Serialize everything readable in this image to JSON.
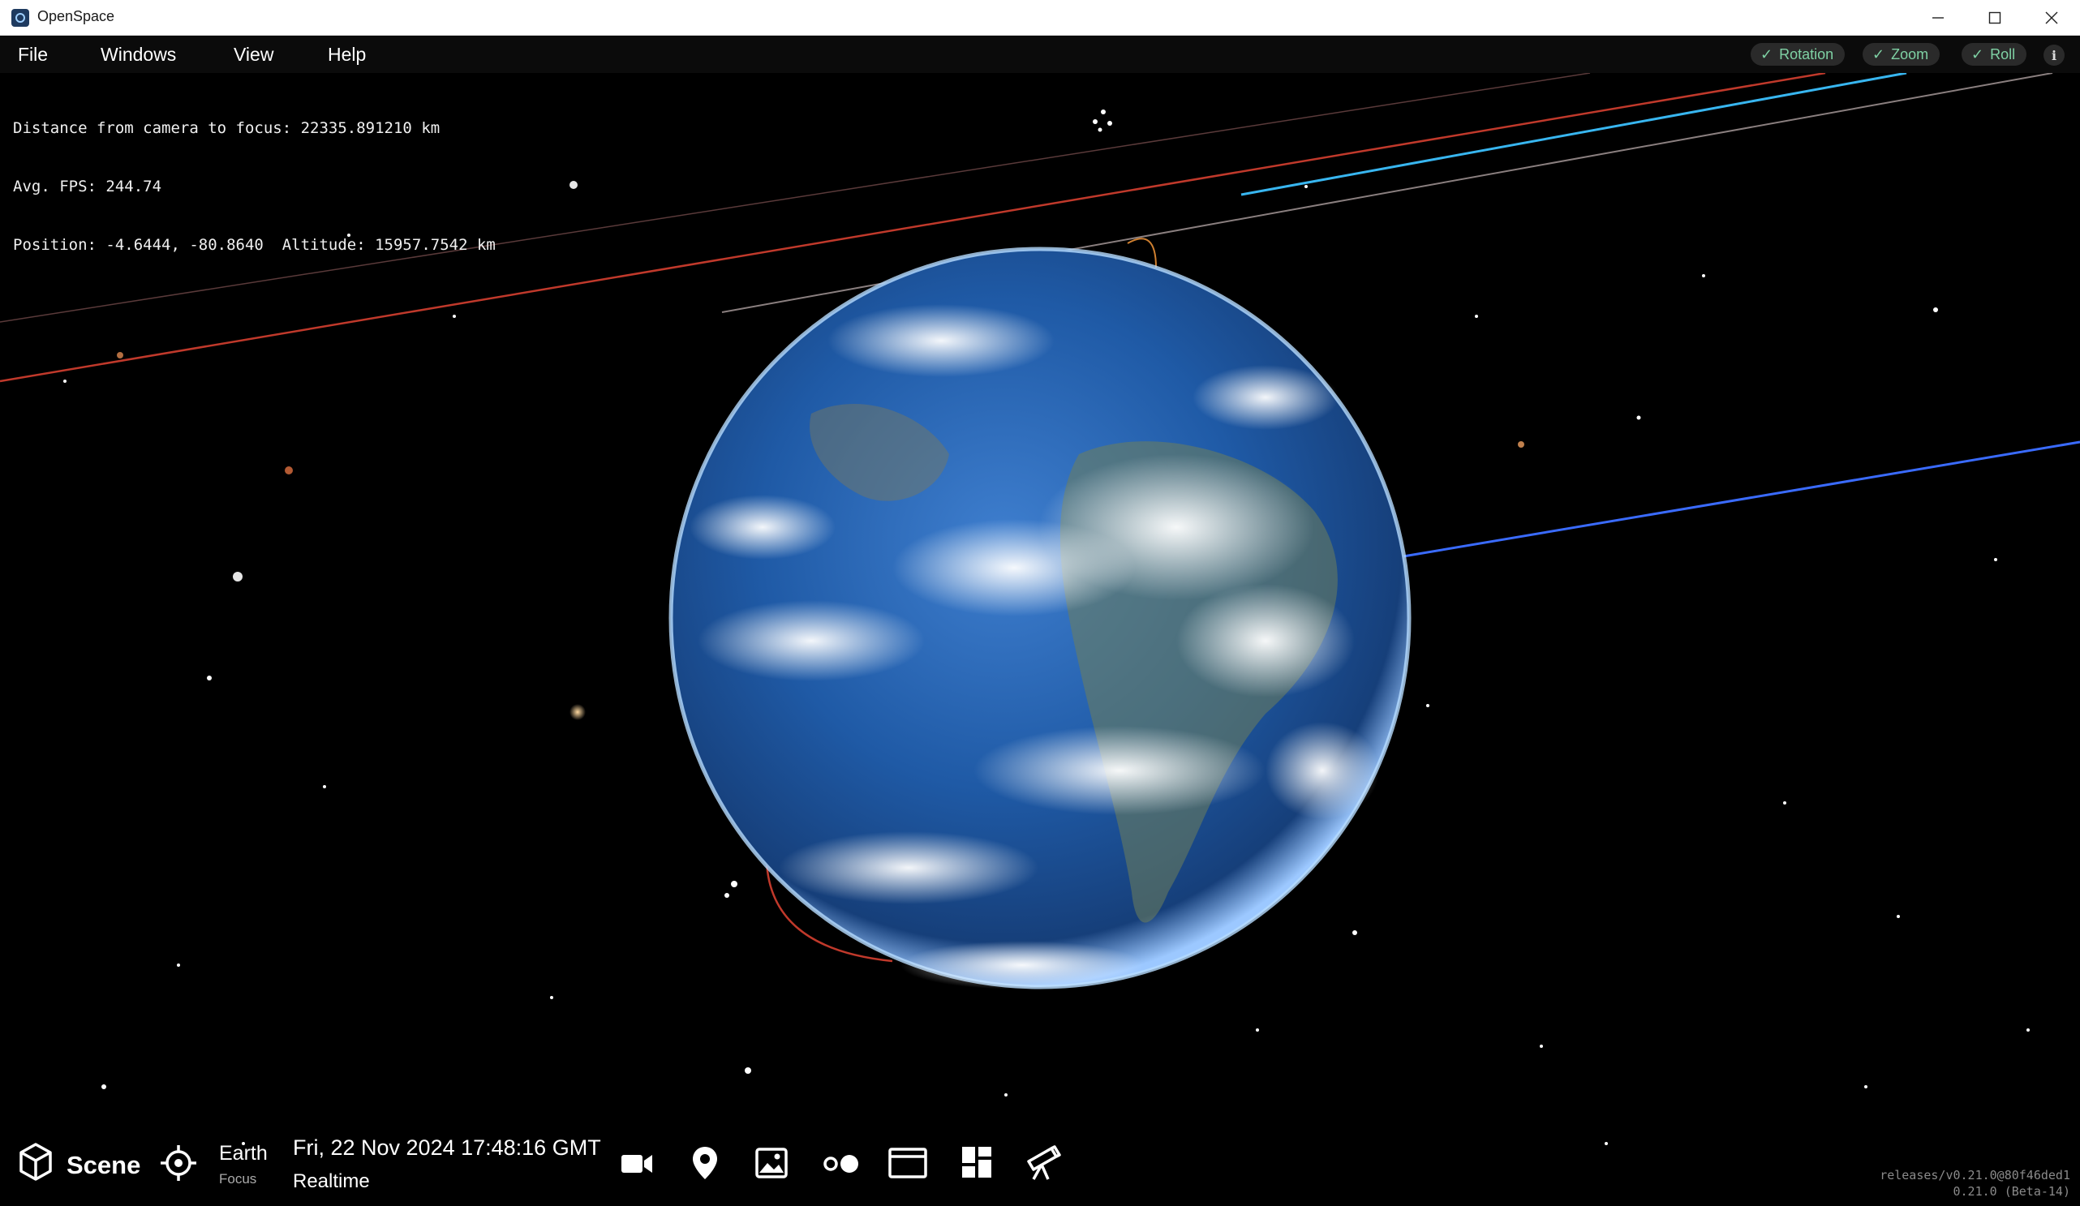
{
  "window": {
    "title": "OpenSpace"
  },
  "menu": {
    "items": [
      "File",
      "Windows",
      "View",
      "Help"
    ]
  },
  "toggles": [
    {
      "label": "Rotation",
      "checked": true
    },
    {
      "label": "Zoom",
      "checked": true
    },
    {
      "label": "Roll",
      "checked": true
    }
  ],
  "info_button": "i",
  "hud": {
    "line1": "Distance from camera to focus: 22335.891210 km",
    "line2": "Avg. FPS: 244.74",
    "line3": "Position: -4.6444, -80.8640  Altitude: 15957.7542 km"
  },
  "bottom_bar": {
    "scene_label": "Scene",
    "focus_name": "Earth",
    "focus_caption": "Focus",
    "date_time": "Fri, 22 Nov 2024 17:48:16 GMT",
    "time_mode": "Realtime",
    "icons": [
      "camera-icon",
      "pin-icon",
      "image-icon",
      "dots-icon",
      "window-icon",
      "dashboard-icon",
      "telescope-icon"
    ]
  },
  "version": {
    "line1": "releases/v0.21.0@80f46ded1",
    "line2": "0.21.0 (Beta-14)"
  },
  "colors": {
    "pill_text": "#7fd1a4",
    "pill_bg": "#2a2a2a",
    "menubar_bg": "#0b0b0b",
    "earth_ocean": "#1e4f95"
  }
}
